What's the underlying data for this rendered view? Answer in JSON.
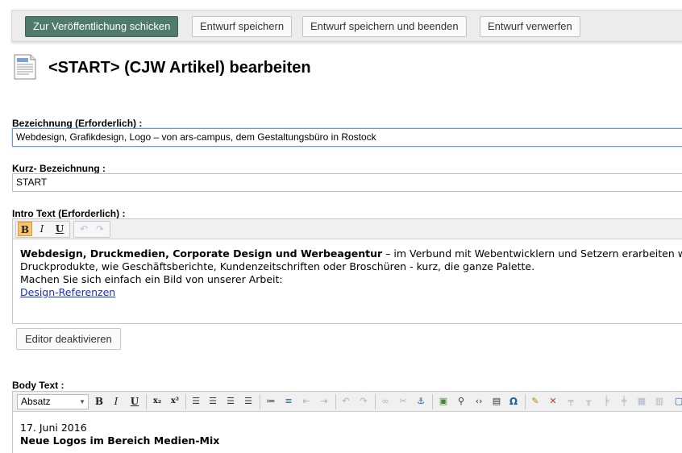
{
  "actions": {
    "publish": "Zur Veröffentlichung schicken",
    "save_draft": "Entwurf speichern",
    "save_and_exit": "Entwurf speichern und beenden",
    "discard": "Entwurf verwerfen"
  },
  "page": {
    "title": "<START> (CJW Artikel) bearbeiten",
    "icon": "document-icon"
  },
  "fields": {
    "bezeichnung": {
      "label": "Bezeichnung (Erforderlich) :",
      "value": "Webdesign, Grafikdesign, Logo – von ars-campus, dem Gestaltungsbüro in Rostock"
    },
    "kurz": {
      "label": "Kurz- Bezeichnung :",
      "value": "START"
    },
    "intro": {
      "label": "Intro Text (Erforderlich) :",
      "bold_text": "Webdesign, Druckmedien, Corporate Design und Werbeagentur",
      "text_after_bold": " – im Verbund mit Webentwicklern und Setzern erarbeiten wir gra",
      "line2": "Druckprodukte, wie Geschäftsberichte, Kundenzeitschriften oder Broschüren - kurz, die ganze Palette.",
      "line3": "Machen Sie sich einfach ein Bild von unserer Arbeit:",
      "link": "Design-Referenzen",
      "deactivate": "Editor deaktivieren"
    },
    "body": {
      "label": "Body Text :",
      "format_value": "Absatz",
      "line1": "17. Juni 2016",
      "line2": "Neue Logos im Bereich Medien-Mix"
    }
  },
  "toolbar": {
    "bold": "B",
    "italic": "I",
    "underline": "U",
    "subscript": "x₂",
    "superscript": "x²",
    "special_char": "Ω"
  },
  "colors": {
    "publish": "#4f7a6c",
    "active_button": "#f7c36b",
    "link": "#1a33b0"
  }
}
